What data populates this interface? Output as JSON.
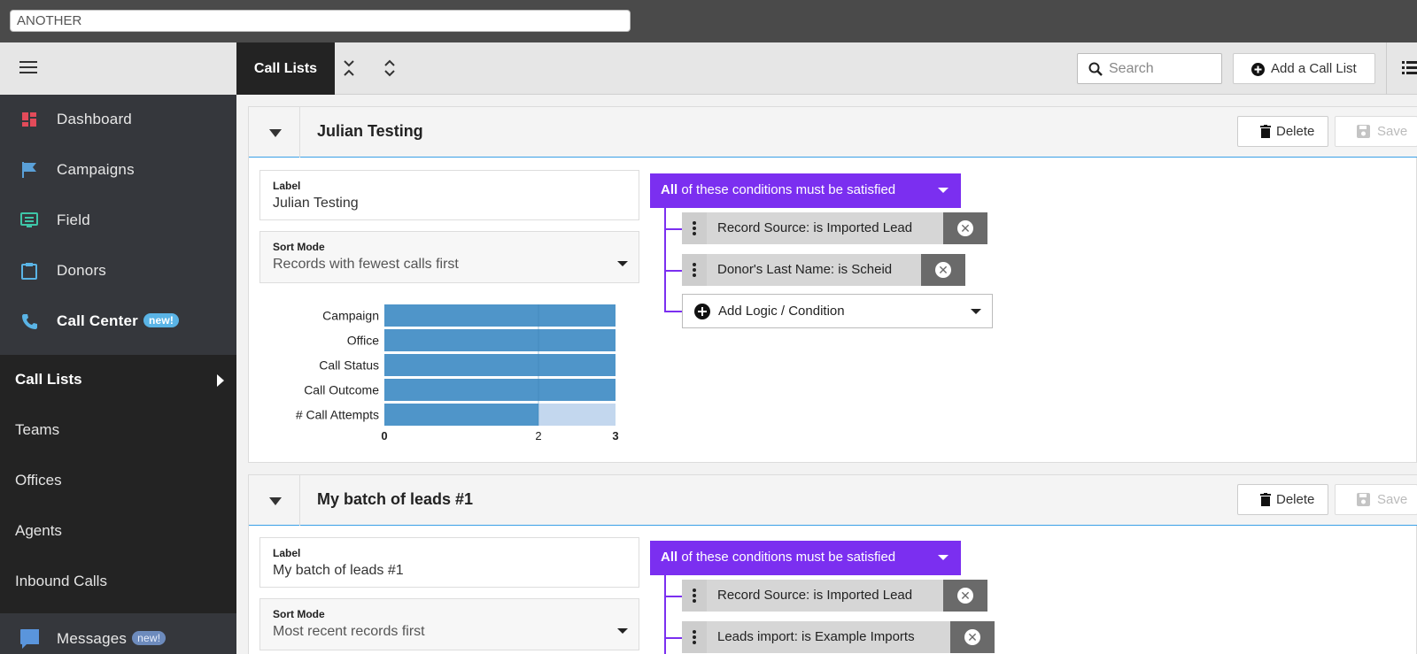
{
  "topbar": {
    "input_value": "ANOTHER"
  },
  "sidebar": {
    "items": [
      {
        "label": "Dashboard",
        "icon": "dashboard-icon"
      },
      {
        "label": "Campaigns",
        "icon": "flag-icon"
      },
      {
        "label": "Field",
        "icon": "field-icon"
      },
      {
        "label": "Donors",
        "icon": "clipboard-icon"
      },
      {
        "label": "Call Center",
        "icon": "phone-icon",
        "badge": "new!"
      }
    ],
    "subitems": [
      {
        "label": "Call Lists"
      },
      {
        "label": "Teams"
      },
      {
        "label": "Offices"
      },
      {
        "label": "Agents"
      },
      {
        "label": "Inbound Calls"
      }
    ],
    "messages": {
      "label": "Messages",
      "badge": "new!",
      "icon": "chat-icon"
    }
  },
  "toolbar": {
    "tab_label": "Call Lists",
    "search_placeholder": "Search",
    "add_label": "Add a Call List"
  },
  "colors": {
    "accent": "#7b2ff0",
    "link": "#3aa0e6",
    "bar": "#4f95c9",
    "bar_light": "#c3d7ee"
  },
  "cards": [
    {
      "title": "Julian Testing",
      "delete_label": "Delete",
      "save_label": "Save",
      "label_field": {
        "label": "Label",
        "value": "Julian Testing"
      },
      "sort_field": {
        "label": "Sort Mode",
        "value": "Records with fewest calls first"
      },
      "condition_header": {
        "prefix": "All",
        "text": "of these conditions must be satisfied"
      },
      "conditions": [
        "Record Source: is Imported Lead",
        "Donor's Last Name: is Scheid"
      ],
      "add_condition_label": "Add Logic / Condition"
    },
    {
      "title": "My batch of leads #1",
      "delete_label": "Delete",
      "save_label": "Save",
      "label_field": {
        "label": "Label",
        "value": "My batch of leads #1"
      },
      "sort_field": {
        "label": "Sort Mode",
        "value": "Most recent records first"
      },
      "condition_header": {
        "prefix": "All",
        "text": "of these conditions must be satisfied"
      },
      "conditions": [
        "Record Source: is Imported Lead",
        "Leads import: is Example Imports"
      ]
    }
  ],
  "chart_data": {
    "type": "bar",
    "orientation": "horizontal",
    "categories": [
      "Campaign",
      "Office",
      "Call Status",
      "Call Outcome",
      "# Call Attempts"
    ],
    "series": [
      {
        "values": [
          3,
          3,
          3,
          3,
          2
        ]
      }
    ],
    "x_ticks": [
      "0",
      "2",
      "3"
    ],
    "xlim": [
      0,
      3
    ],
    "grid": false
  }
}
